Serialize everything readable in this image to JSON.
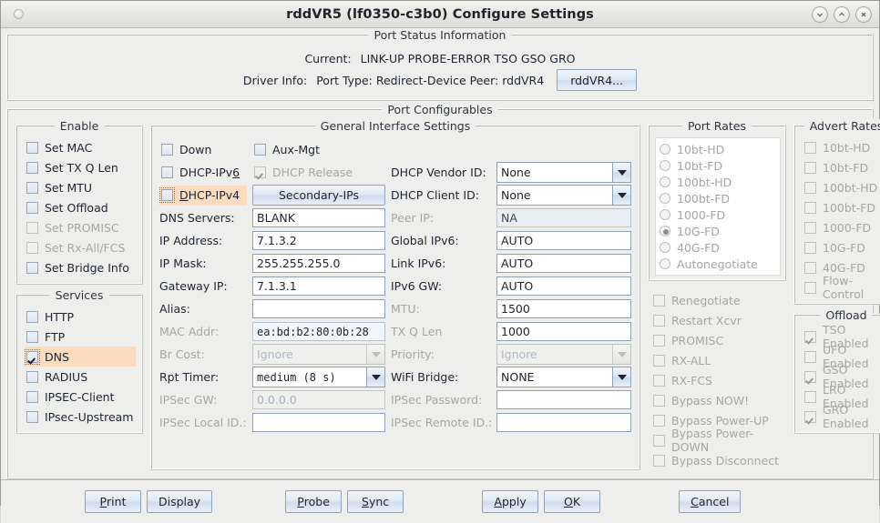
{
  "window": {
    "title": "rddVR5  (lf0350-c3b0) Configure Settings",
    "buttons": [
      {
        "name": "minimize-button",
        "icon": "chevron-down-icon"
      },
      {
        "name": "maximize-button",
        "icon": "chevron-up-icon"
      },
      {
        "name": "close-button",
        "icon": "close-icon"
      }
    ]
  },
  "port_status": {
    "title": "Port Status Information",
    "current_label": "Current:",
    "current_value": "LINK-UP PROBE-ERROR TSO GSO GRO",
    "driver_label": "Driver Info:",
    "driver_value": "Port Type: Redirect-Device   Peer: rddVR4",
    "peer_button": "rddVR4..."
  },
  "port_configurables": {
    "title": "Port Configurables"
  },
  "enable": {
    "title": "Enable",
    "items": [
      {
        "label": "Set MAC",
        "checked": false,
        "disabled": false
      },
      {
        "label": "Set TX Q Len",
        "checked": false,
        "disabled": false
      },
      {
        "label": "Set MTU",
        "checked": false,
        "disabled": false
      },
      {
        "label": "Set Offload",
        "checked": false,
        "disabled": false
      },
      {
        "label": "Set PROMISC",
        "checked": false,
        "disabled": true
      },
      {
        "label": "Set Rx-All/FCS",
        "checked": false,
        "disabled": true
      },
      {
        "label": "Set Bridge Info",
        "checked": false,
        "disabled": false
      }
    ]
  },
  "services": {
    "title": "Services",
    "items": [
      {
        "label": "HTTP",
        "checked": false,
        "disabled": false,
        "highlighted": false
      },
      {
        "label": "FTP",
        "checked": false,
        "disabled": false,
        "highlighted": false
      },
      {
        "label": "DNS",
        "checked": true,
        "disabled": false,
        "highlighted": true
      },
      {
        "label": "RADIUS",
        "checked": false,
        "disabled": false,
        "highlighted": false
      },
      {
        "label": "IPSEC-Client",
        "checked": false,
        "disabled": false,
        "highlighted": false
      },
      {
        "label": "IPsec-Upstream",
        "checked": false,
        "disabled": false,
        "highlighted": false
      }
    ]
  },
  "general": {
    "title": "General Interface Settings",
    "down": {
      "label": "Down",
      "checked": false
    },
    "aux_mgt": {
      "label": "Aux-Mgt",
      "checked": false
    },
    "dhcp_ipv6": {
      "label": "DHCP-IPv6",
      "checked": false
    },
    "dhcp_release": {
      "label": "DHCP Release",
      "checked": true,
      "disabled": true
    },
    "dhcp_ipv4": {
      "label": "DHCP-IPv4",
      "checked": false,
      "highlighted": true
    },
    "secondary_ips_button": "Secondary-IPs",
    "left_fields": [
      {
        "label": "DNS Servers:",
        "value": "BLANK",
        "kind": "text"
      },
      {
        "label": "IP Address:",
        "value": "7.1.3.2",
        "kind": "text"
      },
      {
        "label": "IP Mask:",
        "value": "255.255.255.0",
        "kind": "text"
      },
      {
        "label": "Gateway IP:",
        "value": "7.1.3.1",
        "kind": "text"
      },
      {
        "label": "Alias:",
        "value": "",
        "kind": "text"
      },
      {
        "label": "MAC Addr:",
        "value": "ea:bd:b2:80:0b:28",
        "kind": "mono",
        "disabled": true
      },
      {
        "label": "Br Cost:",
        "value": "Ignore",
        "kind": "combo",
        "disabled": true
      },
      {
        "label": "Rpt Timer:",
        "value": "medium  (8 s)",
        "kind": "combo-mono",
        "disabled": false
      },
      {
        "label": "IPSec GW:",
        "value": "0.0.0.0",
        "kind": "placeholder",
        "disabled": true
      },
      {
        "label": "IPSec Local ID.:",
        "value": "",
        "kind": "text",
        "disabled": true
      }
    ],
    "right_fields": [
      {
        "label": "DHCP Vendor ID:",
        "value": "None",
        "kind": "combo",
        "disabled": false
      },
      {
        "label": "DHCP Client ID:",
        "value": "None",
        "kind": "combo",
        "disabled": false
      },
      {
        "label": "Peer IP:",
        "value": "NA",
        "kind": "readonly",
        "disabled": true
      },
      {
        "label": "Global IPv6:",
        "value": "AUTO",
        "kind": "text"
      },
      {
        "label": "Link IPv6:",
        "value": "AUTO",
        "kind": "text"
      },
      {
        "label": "IPv6 GW:",
        "value": "AUTO",
        "kind": "text"
      },
      {
        "label": "MTU:",
        "value": "1500",
        "kind": "text",
        "disabled": true
      },
      {
        "label": "TX Q Len",
        "value": "1000",
        "kind": "text",
        "disabled": true
      },
      {
        "label": "Priority:",
        "value": "Ignore",
        "kind": "combo",
        "disabled": true
      },
      {
        "label": "WiFi Bridge:",
        "value": "NONE",
        "kind": "combo",
        "disabled": false
      },
      {
        "label": "IPSec Password:",
        "value": "",
        "kind": "text",
        "disabled": true
      },
      {
        "label": "IPSec Remote ID.:",
        "value": "",
        "kind": "text",
        "disabled": true
      }
    ]
  },
  "port_rates": {
    "title": "Port Rates",
    "options": [
      {
        "label": "10bt-HD",
        "selected": false
      },
      {
        "label": "10bt-FD",
        "selected": false
      },
      {
        "label": "100bt-HD",
        "selected": false
      },
      {
        "label": "100bt-FD",
        "selected": false
      },
      {
        "label": "1000-FD",
        "selected": false
      },
      {
        "label": "10G-FD",
        "selected": true
      },
      {
        "label": "40G-FD",
        "selected": false
      },
      {
        "label": "Autonegotiate",
        "selected": false
      }
    ],
    "checks": [
      {
        "label": "Renegotiate",
        "checked": false
      },
      {
        "label": "Restart Xcvr",
        "checked": false
      },
      {
        "label": "PROMISC",
        "checked": false
      },
      {
        "label": "RX-ALL",
        "checked": false
      },
      {
        "label": "RX-FCS",
        "checked": false
      },
      {
        "label": "Bypass NOW!",
        "checked": false
      },
      {
        "label": "Bypass Power-UP",
        "checked": false
      },
      {
        "label": "Bypass Power-DOWN",
        "checked": false
      },
      {
        "label": "Bypass Disconnect",
        "checked": false
      }
    ]
  },
  "advert_rates": {
    "title": "Advert Rates",
    "items": [
      {
        "label": "10bt-HD",
        "checked": false
      },
      {
        "label": "10bt-FD",
        "checked": false
      },
      {
        "label": "100bt-HD",
        "checked": false
      },
      {
        "label": "100bt-FD",
        "checked": false
      },
      {
        "label": "1000-FD",
        "checked": false
      },
      {
        "label": "10G-FD",
        "checked": false
      },
      {
        "label": "40G-FD",
        "checked": false
      },
      {
        "label": "Flow-Control",
        "checked": false
      }
    ]
  },
  "offload": {
    "title": "Offload",
    "items": [
      {
        "label": "TSO Enabled",
        "checked": true
      },
      {
        "label": "UFO Enabled",
        "checked": false
      },
      {
        "label": "GSO Enabled",
        "checked": true
      },
      {
        "label": "LRO Enabled",
        "checked": false
      },
      {
        "label": "GRO Enabled",
        "checked": true
      }
    ]
  },
  "footer": {
    "buttons": [
      {
        "name": "print-button",
        "pre": "",
        "mnemonic": "P",
        "post": "rint"
      },
      {
        "name": "display-button",
        "pre": "Display",
        "mnemonic": "",
        "post": ""
      },
      {
        "name": "probe-button",
        "pre": "",
        "mnemonic": "P",
        "post": "robe"
      },
      {
        "name": "sync-button",
        "pre": "",
        "mnemonic": "S",
        "post": "ync"
      },
      {
        "name": "apply-button",
        "pre": "",
        "mnemonic": "A",
        "post": "pply"
      },
      {
        "name": "ok-button",
        "pre": "",
        "mnemonic": "O",
        "post": "K"
      },
      {
        "name": "cancel-button",
        "pre": "",
        "mnemonic": "C",
        "post": "ancel"
      }
    ]
  }
}
